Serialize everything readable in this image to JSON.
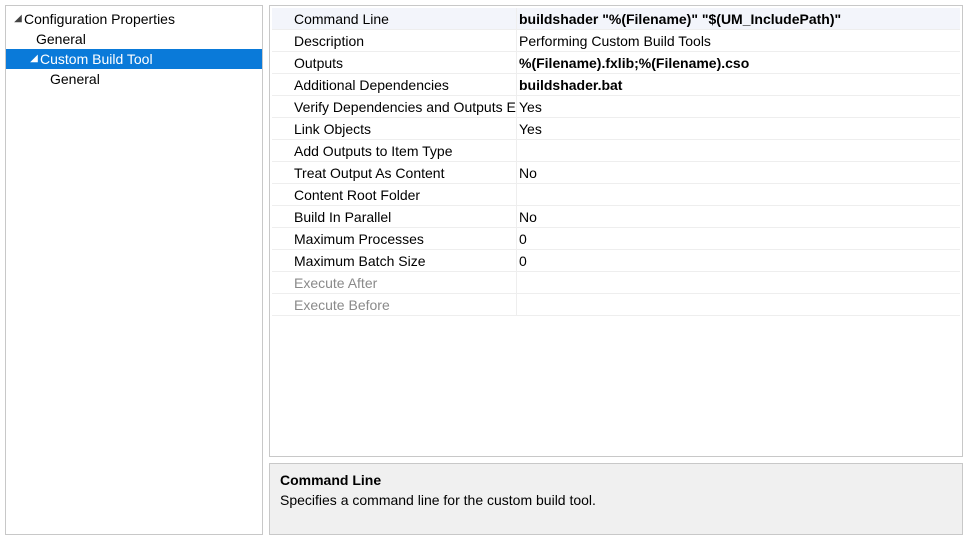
{
  "sidebar": {
    "root": {
      "label": "Configuration Properties",
      "expanded": true
    },
    "items": [
      {
        "label": "General"
      },
      {
        "label": "Custom Build Tool",
        "selected": true,
        "expanded": true
      },
      {
        "label": "General"
      }
    ]
  },
  "properties": [
    {
      "label": "Command Line",
      "value": "buildshader \"%(Filename)\" \"$(UM_IncludePath)\"",
      "bold": true,
      "selected": true
    },
    {
      "label": "Description",
      "value": "Performing Custom Build Tools"
    },
    {
      "label": "Outputs",
      "value": "%(Filename).fxlib;%(Filename).cso",
      "bold": true
    },
    {
      "label": "Additional Dependencies",
      "value": "buildshader.bat",
      "bold": true
    },
    {
      "label": "Verify Dependencies and Outputs Exist",
      "value": "Yes"
    },
    {
      "label": "Link Objects",
      "value": "Yes"
    },
    {
      "label": "Add Outputs to Item Type",
      "value": ""
    },
    {
      "label": "Treat Output As Content",
      "value": "No"
    },
    {
      "label": "Content Root Folder",
      "value": ""
    },
    {
      "label": "Build In Parallel",
      "value": "No"
    },
    {
      "label": "Maximum Processes",
      "value": "0"
    },
    {
      "label": "Maximum Batch Size",
      "value": "0"
    },
    {
      "label": "Execute After",
      "value": "",
      "disabled": true
    },
    {
      "label": "Execute Before",
      "value": "",
      "disabled": true
    }
  ],
  "description": {
    "title": "Command Line",
    "body": "Specifies a command line for the custom build tool."
  }
}
